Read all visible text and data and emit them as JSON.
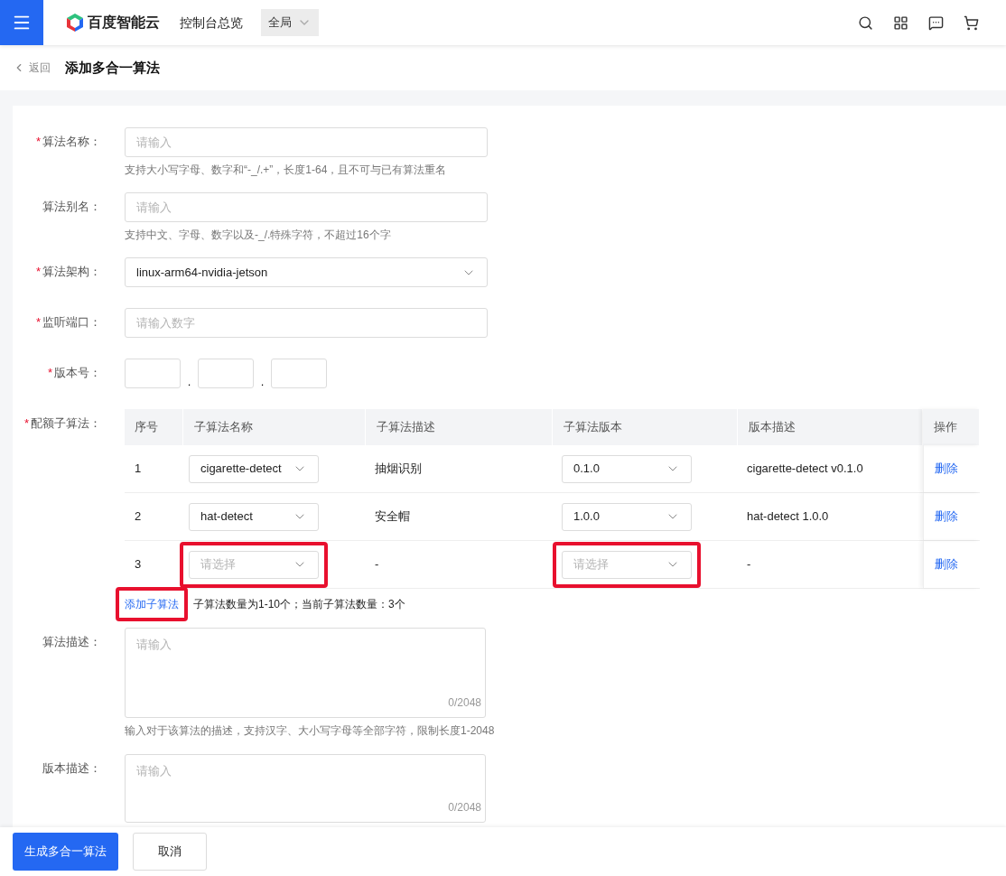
{
  "header": {
    "brand": "百度智能云",
    "console": "控制台总览",
    "region": "全局"
  },
  "subheader": {
    "back": "返回",
    "title": "添加多合一算法"
  },
  "form": {
    "fields": [
      {
        "kind": "input",
        "marker": "*",
        "label": "算法名称：",
        "placeholder": "请输入",
        "hint": "支持大小写字母、数字和“-_/.+”，长度1-64，且不可与已有算法重名"
      },
      {
        "kind": "input",
        "label": "算法别名：",
        "placeholder": "请输入",
        "hint": "支持中文、字母、数字以及-_/.特殊字符，不超过16个字"
      },
      {
        "kind": "select",
        "marker": "*",
        "label": "算法架构：",
        "value": "linux-arm64-nvidia-jetson"
      },
      {
        "kind": "input",
        "marker": "*",
        "label": "监听端口：",
        "placeholder": "请输入数字"
      },
      {
        "kind": "version",
        "marker": "*",
        "label": "版本号：",
        "separators": [
          ".",
          "."
        ]
      }
    ],
    "sub_algorithms": {
      "marker": "*",
      "label": "配额子算法：",
      "columns": [
        "序号",
        "子算法名称",
        "子算法描述",
        "子算法版本",
        "版本描述",
        "操作"
      ],
      "rows": [
        {
          "index": "1",
          "name": {
            "value": "cigarette-detect",
            "highlighted": false
          },
          "description": "抽烟识别",
          "version": {
            "value": "0.1.0",
            "highlighted": false
          },
          "version_description": "cigarette-detect v0.1.0",
          "action": "删除"
        },
        {
          "index": "2",
          "name": {
            "value": "hat-detect",
            "highlighted": false
          },
          "description": "安全帽",
          "version": {
            "value": "1.0.0",
            "highlighted": false
          },
          "version_description": "hat-detect 1.0.0",
          "action": "删除"
        },
        {
          "index": "3",
          "name": {
            "placeholder": "请选择",
            "highlighted": true
          },
          "description": "-",
          "version": {
            "placeholder": "请选择",
            "highlighted": true
          },
          "version_description": "-",
          "action": "删除"
        }
      ],
      "add_button": {
        "label": "添加子算法",
        "highlighted": true
      },
      "count_note": "子算法数量为1-10个；当前子算法数量：3个"
    },
    "textareas": [
      {
        "label": "算法描述：",
        "placeholder": "请输入",
        "counter": "0/2048",
        "hint": "输入对于该算法的描述，支持汉字、大小写字母等全部字符，限制长度1-2048"
      },
      {
        "label": "版本描述：",
        "placeholder": "请输入",
        "counter": "0/2048"
      }
    ]
  },
  "footer": {
    "buttons": [
      {
        "label": "生成多合一算法",
        "kind": "primary"
      },
      {
        "label": "取消",
        "kind": "default"
      }
    ]
  }
}
